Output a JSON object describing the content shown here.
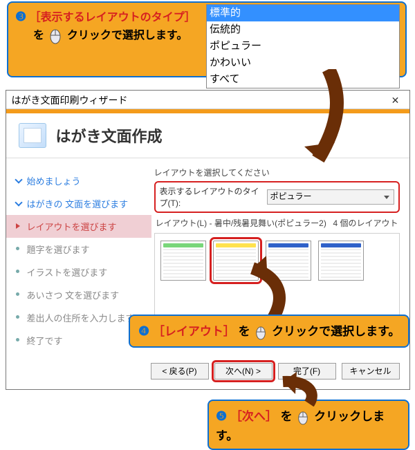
{
  "callout3": {
    "num": "❸",
    "bracket": "［表示するレイアウトのタイプ］",
    "line2a": "を",
    "line2b": "クリックで選択します。"
  },
  "dropdown": {
    "options": [
      "標準的",
      "伝統的",
      "ポピュラー",
      "かわいい",
      "すべて"
    ],
    "selected_index": 0
  },
  "wizard": {
    "titlebar": "はがき文面印刷ウィザード",
    "title": "はがき文面作成",
    "steps": [
      {
        "label": "始めましょう",
        "state": "done"
      },
      {
        "label": "はがきの 文面を選びます",
        "state": "done"
      },
      {
        "label": "レイアウトを選びます",
        "state": "current"
      },
      {
        "label": "題字を選びます",
        "state": "pending"
      },
      {
        "label": "イラストを選びます",
        "state": "pending"
      },
      {
        "label": "あいさつ 文を選びます",
        "state": "pending"
      },
      {
        "label": "差出人の住所を入力します",
        "state": "pending"
      },
      {
        "label": "終了です",
        "state": "pending"
      }
    ],
    "pane_label": "レイアウトを選択してください",
    "type_label": "表示するレイアウトのタイプ(T):",
    "type_value": "ポピュラー",
    "list_label": "レイアウト(L) - 暑中/残暑見舞い(ポピュラー2)",
    "count_label": "4 個のレイアウト",
    "buttons": {
      "back": "< 戻る(P)",
      "next": "次へ(N) >",
      "finish": "完了(F)",
      "cancel": "キャンセル"
    }
  },
  "callout4": {
    "num": "❹",
    "bracket": "［レイアウト］",
    "mid": "を",
    "tail": "クリックで選択します。"
  },
  "callout5": {
    "num": "❺",
    "bracket": "［次へ］",
    "mid": "を",
    "tail": "クリックします。"
  }
}
